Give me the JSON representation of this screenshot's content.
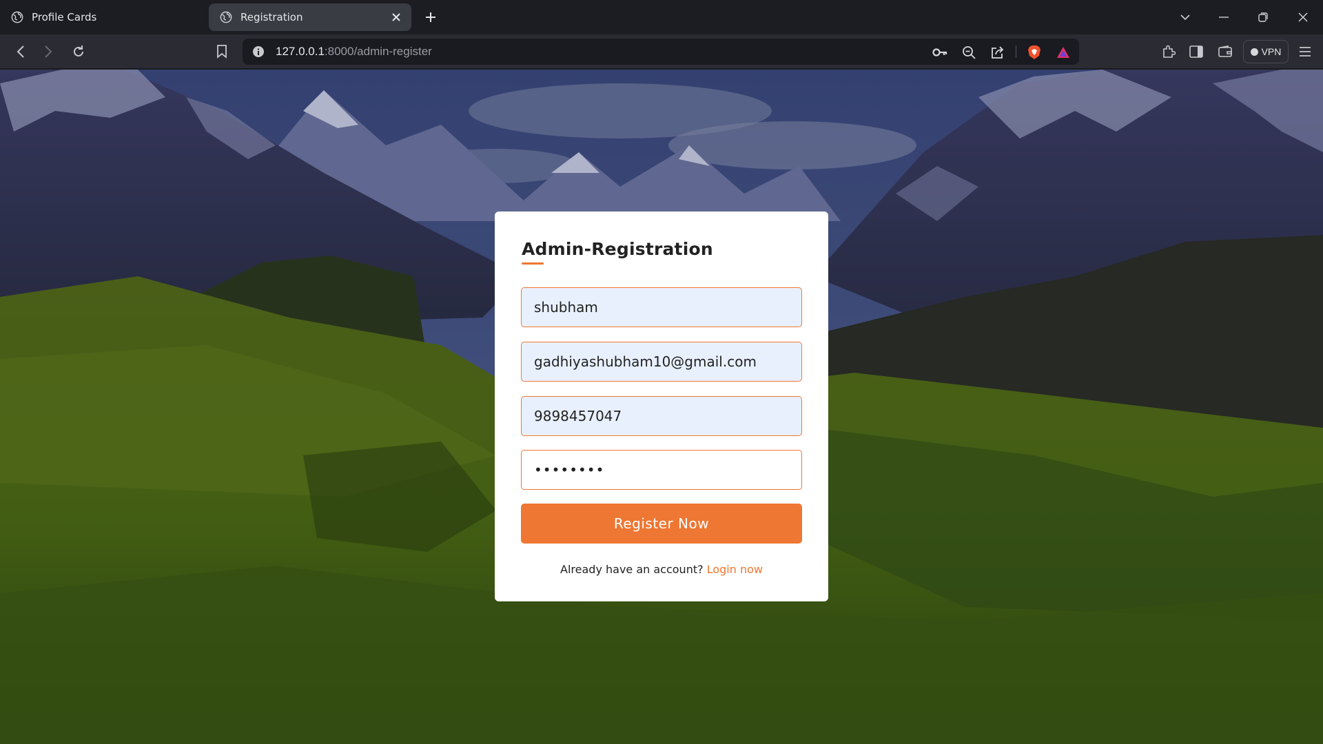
{
  "browser": {
    "tabs": [
      {
        "label": "Profile Cards",
        "active": false
      },
      {
        "label": "Registration",
        "active": true
      }
    ],
    "url_host": "127.0.0.1",
    "url_rest": ":8000/admin-register",
    "vpn_label": "VPN",
    "colors": {
      "tabbar": "#1c1d22",
      "toolbar": "#2b2c33",
      "active_tab": "#3a3c44"
    }
  },
  "form": {
    "title": "Admin-Registration",
    "name_value": "shubham",
    "email_value": "gadhiyashubham10@gmail.com",
    "phone_value": "9898457047",
    "password_value": "shubham1",
    "submit_label": "Register Now",
    "footer_text": "Already have an account?",
    "footer_link": "Login now",
    "accent_color": "#ee7733"
  }
}
